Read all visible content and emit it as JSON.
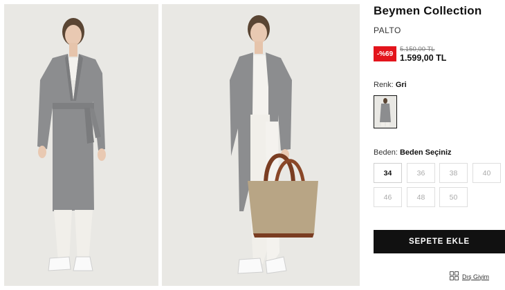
{
  "product": {
    "brand": "Beymen Collection",
    "type": "PALTO",
    "discount": "-%69",
    "old_price": "5.150,00 TL",
    "price": "1.599,00 TL"
  },
  "color": {
    "label": "Renk:",
    "value": "Gri"
  },
  "size": {
    "label": "Beden:",
    "value": "Beden Seçiniz",
    "options": [
      "34",
      "36",
      "38",
      "40",
      "46",
      "48",
      "50"
    ]
  },
  "cart_button": "SEPETE EKLE",
  "category_link": "Dış Giyim",
  "colors": {
    "coat": "#8c8d8f",
    "background": "#e9e8e4",
    "discount": "#e3141c",
    "button": "#111111"
  }
}
